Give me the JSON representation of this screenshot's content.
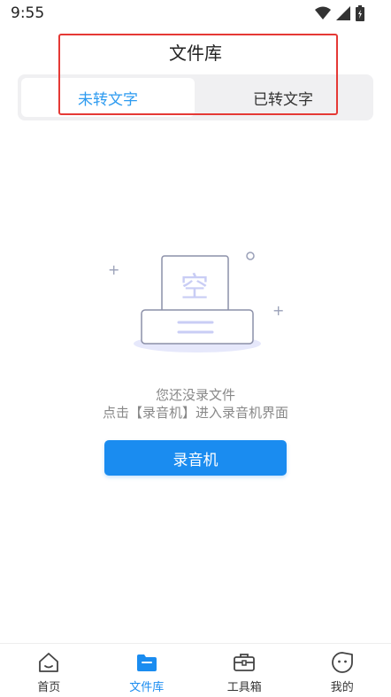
{
  "status_bar": {
    "time": "9:55"
  },
  "header": {
    "title": "文件库"
  },
  "tabs": [
    {
      "label": "未转文字",
      "active": true
    },
    {
      "label": "已转文字",
      "active": false
    }
  ],
  "empty_state": {
    "illustration_text": "空",
    "line1": "您还没录文件",
    "line2": "点击【录音机】进入录音机界面",
    "button_label": "录音机"
  },
  "bottom_nav": [
    {
      "label": "首页",
      "icon": "home-icon",
      "active": false
    },
    {
      "label": "文件库",
      "icon": "folder-icon",
      "active": true
    },
    {
      "label": "工具箱",
      "icon": "toolbox-icon",
      "active": false
    },
    {
      "label": "我的",
      "icon": "profile-icon",
      "active": false
    }
  ],
  "colors": {
    "accent": "#1a8cf0",
    "tab_active_text": "#2d9bf0",
    "highlight": "#e53935"
  }
}
